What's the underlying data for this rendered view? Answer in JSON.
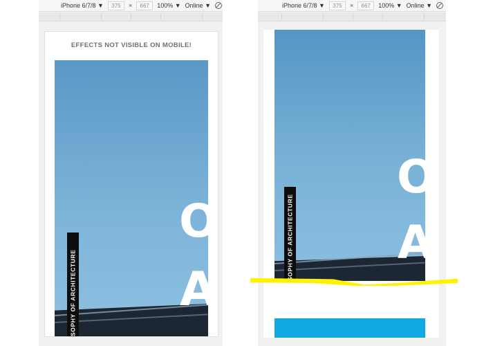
{
  "toolbars": [
    {
      "device": "iPhone 6/7/8 ▼",
      "width": "375",
      "times": "×",
      "height": "667",
      "zoom": "100% ▼",
      "network": "Online ▼",
      "rotate_icon": "rotate-icon"
    },
    {
      "device": "iPhone 6/7/8 ▼",
      "width": "375",
      "times": "×",
      "height": "667",
      "zoom": "100% ▼",
      "network": "Online ▼",
      "rotate_icon": "rotate-icon"
    }
  ],
  "left_page": {
    "notice": "EFFECTS NOT VISIBLE ON MOBILE!",
    "big_letters": [
      "O",
      "A"
    ],
    "vertical_tag": "SOPHY OF ARCHITECTURE"
  },
  "right_page": {
    "big_letters": [
      "O",
      "A"
    ],
    "vertical_tag": "SOPHY OF ARCHITECTURE"
  },
  "colors": {
    "highlight": "#fff200",
    "accent_bar": "#11a9e4",
    "tag_bg": "#0d0d0d",
    "sky": "#7db4d9"
  }
}
